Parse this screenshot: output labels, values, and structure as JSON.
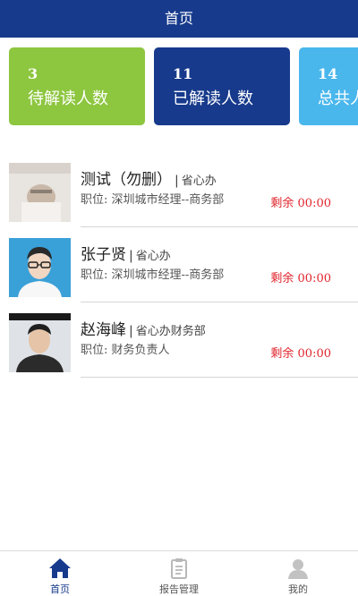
{
  "header": {
    "title": "首页"
  },
  "stats": [
    {
      "value": "3",
      "label": "待解读人数",
      "color": "#8dc63f"
    },
    {
      "value": "11",
      "label": "已解读人数",
      "color": "#173a8c"
    },
    {
      "value": "14",
      "label": "总共人数",
      "color": "#4ab7ec"
    }
  ],
  "people": [
    {
      "name": "测试（勿删）",
      "separator": "|",
      "dept": "省心办",
      "position": "职位:  深圳城市经理--商务部",
      "remaining": "剩余 00:00"
    },
    {
      "name": "张子贤",
      "separator": "|",
      "dept": "省心办",
      "position": "职位:  深圳城市经理--商务部",
      "remaining": "剩余 00:00"
    },
    {
      "name": "赵海峰",
      "separator": "|",
      "dept": "省心办财务部",
      "position": "职位:  财务负责人",
      "remaining": "剩余 00:00"
    }
  ],
  "tabbar": {
    "items": [
      {
        "label": "首页",
        "icon": "home-icon",
        "active": true
      },
      {
        "label": "报告管理",
        "icon": "clipboard-icon",
        "active": false
      },
      {
        "label": "我的",
        "icon": "user-icon",
        "active": false
      }
    ]
  },
  "colors": {
    "primary": "#173a8c",
    "accent_red": "#e0252d"
  }
}
